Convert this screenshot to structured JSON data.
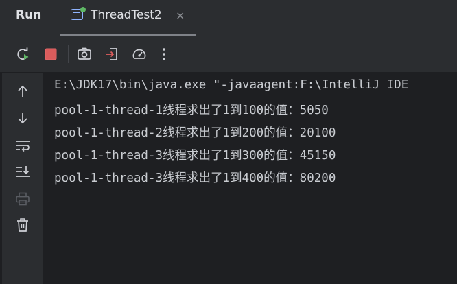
{
  "header": {
    "run_label": "Run",
    "tab_title": "ThreadTest2",
    "tab_close": "×"
  },
  "toolbar": {
    "icons": [
      "rerun-icon",
      "stop-icon",
      "camera-icon",
      "exit-icon",
      "gauge-icon",
      "more-icon"
    ]
  },
  "sidebar": {
    "icons": [
      "arrow-up-icon",
      "arrow-down-icon",
      "soft-wrap-icon",
      "scroll-to-end-icon",
      "print-icon",
      "trash-icon"
    ]
  },
  "console": {
    "lines": [
      "E:\\JDK17\\bin\\java.exe \"-javaagent:F:\\IntelliJ IDE",
      "pool-1-thread-1线程求出了1到100的值：5050",
      "pool-1-thread-2线程求出了1到200的值：20100",
      "pool-1-thread-3线程求出了1到300的值：45150",
      "pool-1-thread-3线程求出了1到400的值：80200"
    ]
  },
  "colors": {
    "background": "#1e1f22",
    "panel": "#2b2d30",
    "text": "#dfe1e5",
    "stop_red": "#db5c5c",
    "rerun_green": "#5fb865",
    "tab_icon_blue": "#8fb4ff"
  }
}
